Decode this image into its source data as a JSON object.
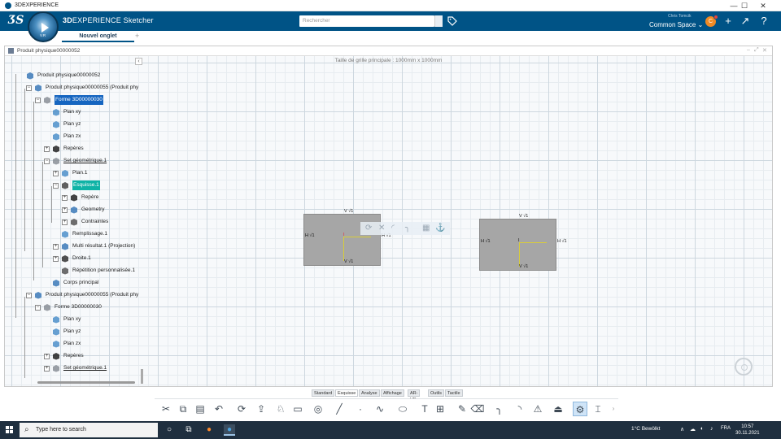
{
  "window": {
    "title": "3DEXPERIENCE",
    "min_glyph": "—",
    "max_glyph": "☐",
    "close_glyph": "✕"
  },
  "topbar": {
    "brand_bold": "3D",
    "brand_rest": "EXPERIENCE Sketcher",
    "search_placeholder": "Rechercher",
    "user_name": "Chris Tomcik",
    "space": "Common Space",
    "avatar_initial": "C",
    "colors": {
      "bar": "#005386",
      "avatar": "#f08a24"
    }
  },
  "compass": {
    "label": "V.R"
  },
  "tabs": {
    "active_label": "Nouvel onglet",
    "add_glyph": "+"
  },
  "document": {
    "title": "Produit physique00000052",
    "grid_label": "Taille de grille principale : 1000mm x 1000mm"
  },
  "tree": {
    "items": [
      {
        "label": "Produit physique00000052",
        "icon": "product-icon"
      },
      {
        "label": "Produit physique00000055 (Produit phy",
        "icon": "product-icon"
      },
      {
        "label": "Forme 3D00000030",
        "icon": "shape-icon"
      },
      {
        "label": "Plan xy",
        "icon": "plane-icon"
      },
      {
        "label": "Plan yz",
        "icon": "plane-icon"
      },
      {
        "label": "Plan zx",
        "icon": "plane-icon"
      },
      {
        "label": "Repères",
        "icon": "axis-icon"
      },
      {
        "label": "Set géométrique.1",
        "icon": "geoset-icon"
      },
      {
        "label": "Plan.1",
        "icon": "plane-icon"
      },
      {
        "label": "Esquisse.1",
        "icon": "sketch-icon"
      },
      {
        "label": "Repère",
        "icon": "axis-icon"
      },
      {
        "label": "Geometry",
        "icon": "geometry-icon"
      },
      {
        "label": "Contraintes",
        "icon": "constraints-icon"
      },
      {
        "label": "Remplissage.1",
        "icon": "fill-icon"
      },
      {
        "label": "Multi résultat.1 (Projection)",
        "icon": "multi-result-icon"
      },
      {
        "label": "Droite.1",
        "icon": "line-icon"
      },
      {
        "label": "Répétition personnalisée.1",
        "icon": "pattern-icon"
      },
      {
        "label": "Corps principal",
        "icon": "body-icon"
      },
      {
        "label": "Produit physique00000055 (Produit phy",
        "icon": "product-icon"
      },
      {
        "label": "Forme 3D00000030",
        "icon": "shape-icon"
      },
      {
        "label": "Plan xy",
        "icon": "plane-icon"
      },
      {
        "label": "Plan yz",
        "icon": "plane-icon"
      },
      {
        "label": "Plan zx",
        "icon": "plane-icon"
      },
      {
        "label": "Repères",
        "icon": "axis-icon"
      },
      {
        "label": "Set géométrique.1",
        "icon": "geoset-icon"
      }
    ]
  },
  "sketch": {
    "left": {
      "v_top": "V √1",
      "h_left": "H √1",
      "h_right": "H √1",
      "v_bottom": "V √1",
      "center": "I"
    },
    "right": {
      "v_top": "V √1",
      "h_left": "H √1",
      "h_right": "H √1",
      "v_bottom": "V √1",
      "center": "I"
    }
  },
  "actionbar": {
    "tabs": [
      "Standard",
      "Esquisse",
      "Analyse",
      "Affichage",
      "AR-VR",
      "Outils",
      "Tactile"
    ],
    "active_tab": "Esquisse"
  },
  "taskbar": {
    "search_placeholder": "Type here to search",
    "weather": "1°C  Bewölkt",
    "lang": "FRA",
    "time": "10:57",
    "date": "30.11.2021"
  }
}
